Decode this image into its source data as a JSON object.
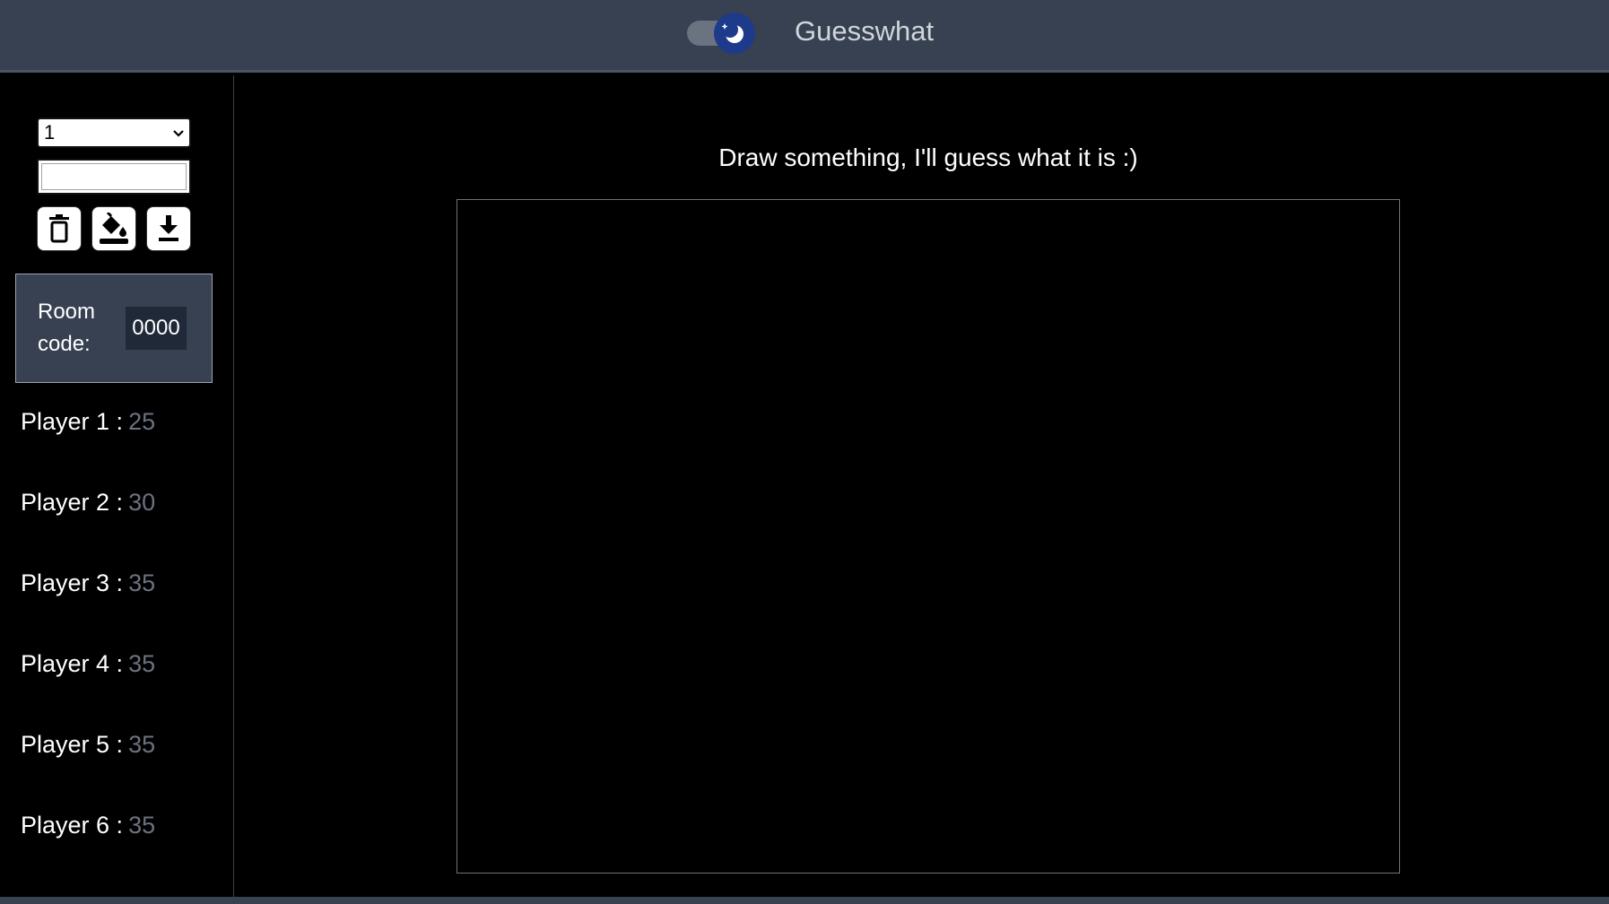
{
  "header": {
    "title": "Guesswhat",
    "theme_toggle_icon": "moon-icon"
  },
  "sidebar": {
    "brush_size_value": "1",
    "color_value": "",
    "tools": [
      {
        "name": "clear-canvas-button",
        "icon": "trash-icon"
      },
      {
        "name": "fill-button",
        "icon": "paint-bucket-icon"
      },
      {
        "name": "download-button",
        "icon": "download-icon"
      }
    ],
    "room": {
      "label": "Room code:",
      "code": "0000"
    },
    "players": [
      {
        "name": "Player 1 :",
        "score": "25"
      },
      {
        "name": "Player 2 :",
        "score": "30"
      },
      {
        "name": "Player 3 :",
        "score": "35"
      },
      {
        "name": "Player 4 :",
        "score": "35"
      },
      {
        "name": "Player 5 :",
        "score": "35"
      },
      {
        "name": "Player 6 :",
        "score": "35"
      }
    ]
  },
  "main": {
    "prompt": "Draw something, I'll guess what it is :)"
  },
  "colors": {
    "header_bg": "#374151",
    "page_bg": "#000000",
    "toggle_knob": "#1e3a8a",
    "score": "#6b7280"
  }
}
